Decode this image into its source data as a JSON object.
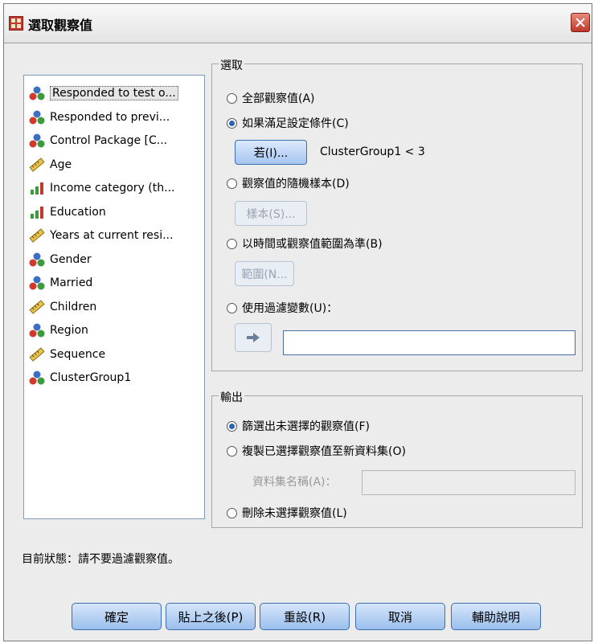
{
  "window": {
    "title": "選取觀察值"
  },
  "variables": [
    {
      "label": "Responded to test o...",
      "icon": "nominal-icon",
      "selected": true
    },
    {
      "label": "Responded to previ...",
      "icon": "nominal-icon"
    },
    {
      "label": "Control Package [C...",
      "icon": "nominal-icon"
    },
    {
      "label": "Age",
      "icon": "scale-ruler-icon"
    },
    {
      "label": "Income category (th...",
      "icon": "ordinal-bar-icon"
    },
    {
      "label": "Education",
      "icon": "ordinal-bar-icon"
    },
    {
      "label": "Years at current resi...",
      "icon": "scale-ruler-icon"
    },
    {
      "label": "Gender",
      "icon": "nominal-icon"
    },
    {
      "label": "Married",
      "icon": "nominal-icon"
    },
    {
      "label": "Children",
      "icon": "scale-ruler-icon"
    },
    {
      "label": "Region",
      "icon": "nominal-icon"
    },
    {
      "label": "Sequence",
      "icon": "scale-ruler-icon"
    },
    {
      "label": "ClusterGroup1",
      "icon": "nominal-icon"
    }
  ],
  "select": {
    "legend": "選取",
    "all_cases": "全部觀察值(A)",
    "if_condition": "如果滿足設定條件(C)",
    "if_button": "若(I)...",
    "condition": "ClusterGroup1 < 3",
    "random_sample": "觀察值的隨機樣本(D)",
    "sample_button": "樣本(S)...",
    "time_range": "以時間或觀察值範圍為準(B)",
    "range_button": "範圍(N...",
    "filter_var": "使用過濾變數(U)："
  },
  "output": {
    "legend": "輸出",
    "filter_out": "篩選出未選擇的觀察值(F)",
    "copy_new": "複製已選擇觀察值至新資料集(O)",
    "dataset_name": "資料集名稱(A)：",
    "delete": "刪除未選擇觀察值(L)"
  },
  "status": "目前狀態：請不要過濾觀察值。",
  "buttons": {
    "ok": "確定",
    "paste": "貼上之後(P)",
    "reset": "重設(R)",
    "cancel": "取消",
    "help": "輔助說明"
  },
  "colors": {
    "accent": "#2a64b8",
    "nominal_red": "#d0392b",
    "nominal_blue": "#3a6fc4",
    "nominal_green": "#3c9a3c",
    "scale_yellow": "#e8c24a",
    "ordinal_red": "#c0392b"
  }
}
